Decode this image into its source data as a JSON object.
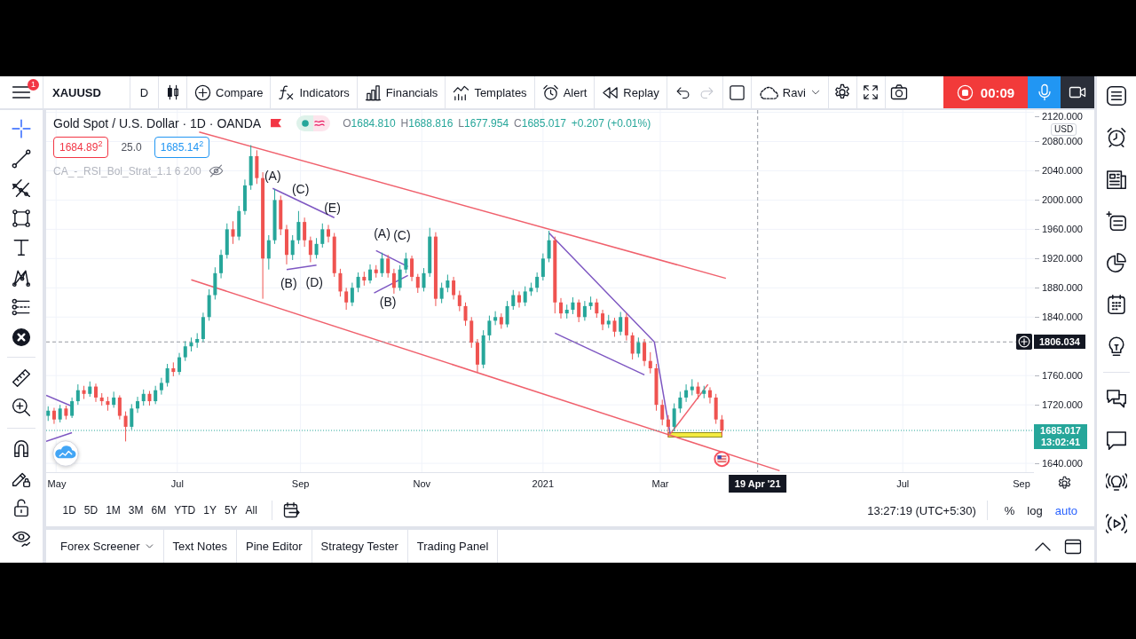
{
  "toolbar": {
    "notification_count": "1",
    "symbol": "XAUUSD",
    "interval": "D",
    "actions": [
      {
        "label": "Compare"
      },
      {
        "label": "Indicators"
      },
      {
        "label": "Financials"
      },
      {
        "label": "Templates"
      },
      {
        "label": "Alert"
      },
      {
        "label": "Replay"
      }
    ],
    "history": [
      {
        "disabled": false
      },
      {
        "disabled": true
      }
    ],
    "layout_name": "Ravi"
  },
  "recorder": {
    "elapsed": "00:09"
  },
  "drawing_tools": [
    {
      "tools": [
        {
          "selected": true
        },
        {
          "selected": false
        },
        {
          "selected": false
        },
        {
          "selected": false
        },
        {
          "selected": false
        },
        {
          "selected": false
        },
        {
          "selected": false
        },
        {
          "selected": false
        }
      ]
    },
    {
      "tools": [
        {
          "selected": false
        },
        {
          "selected": false
        }
      ]
    },
    {
      "tools": [
        {
          "selected": false
        },
        {
          "selected": false
        },
        {
          "selected": false
        },
        {
          "selected": false
        }
      ]
    }
  ],
  "chart": {
    "legend": {
      "title": "Gold Spot / U.S. Dollar · 1D · OANDA",
      "ohlc": [
        {
          "label": "O",
          "value": "1684.810"
        },
        {
          "label": "H",
          "value": "1688.816"
        },
        {
          "label": "L",
          "value": "1677.954"
        },
        {
          "label": "C",
          "value": "1685.017"
        }
      ],
      "change": "+0.207 (+0.01%)",
      "sell_price": "1684.89$^{2}$",
      "spread": "25.0",
      "buy_price": "1685.14$^{2}$",
      "indicator": {
        "name": "CA_-_RSI_Bol_Strat_1.1 6 200",
        "hidden": true
      }
    },
    "currency": "USD",
    "countdown": "13:02:41",
    "chart_data": [
      {
        "type": "candlestick",
        "x": [
          "2020-04-27",
          "2020-04-30",
          "2020-05-03",
          "2020-05-06",
          "2020-05-09",
          "2020-05-12",
          "2020-05-15",
          "2020-05-18",
          "2020-05-21",
          "2020-05-24",
          "2020-05-27",
          "2020-05-30",
          "2020-06-02",
          "2020-06-05",
          "2020-06-08",
          "2020-06-11",
          "2020-06-14",
          "2020-06-17",
          "2020-06-20",
          "2020-06-23",
          "2020-06-26",
          "2020-06-29",
          "2020-07-02",
          "2020-07-05",
          "2020-07-08",
          "2020-07-11",
          "2020-07-14",
          "2020-07-17",
          "2020-07-20",
          "2020-07-23",
          "2020-07-26",
          "2020-07-29",
          "2020-08-01",
          "2020-08-04",
          "2020-08-07",
          "2020-08-10",
          "2020-08-13",
          "2020-08-16",
          "2020-08-19",
          "2020-08-22",
          "2020-08-25",
          "2020-08-28",
          "2020-08-31",
          "2020-09-03",
          "2020-09-06",
          "2020-09-09",
          "2020-09-12",
          "2020-09-15",
          "2020-09-18",
          "2020-09-21",
          "2020-09-24",
          "2020-09-27",
          "2020-09-30",
          "2020-10-03",
          "2020-10-06",
          "2020-10-09",
          "2020-10-12",
          "2020-10-15",
          "2020-10-18",
          "2020-10-21",
          "2020-10-24",
          "2020-10-27",
          "2020-10-30",
          "2020-11-02",
          "2020-11-05",
          "2020-11-08",
          "2020-11-11",
          "2020-11-14",
          "2020-11-17",
          "2020-11-20",
          "2020-11-23",
          "2020-11-26",
          "2020-11-29",
          "2020-12-02",
          "2020-12-05",
          "2020-12-08",
          "2020-12-11",
          "2020-12-14",
          "2020-12-17",
          "2020-12-20",
          "2020-12-23",
          "2020-12-26",
          "2020-12-29",
          "2021-01-01",
          "2021-01-04",
          "2021-01-07",
          "2021-01-10",
          "2021-01-13",
          "2021-01-16",
          "2021-01-19",
          "2021-01-22",
          "2021-01-25",
          "2021-01-28",
          "2021-01-31",
          "2021-02-03",
          "2021-02-06",
          "2021-02-09",
          "2021-02-12",
          "2021-02-15",
          "2021-02-18",
          "2021-02-21",
          "2021-02-24",
          "2021-02-27",
          "2021-03-02",
          "2021-03-05",
          "2021-03-08",
          "2021-03-11",
          "2021-03-14",
          "2021-03-17",
          "2021-03-20",
          "2021-03-23",
          "2021-03-26",
          "2021-03-29",
          "2021-04-01"
        ],
        "ohlc": [
          [
            1705,
            1718,
            1698,
            1712
          ],
          [
            1712,
            1716,
            1694,
            1700
          ],
          [
            1700,
            1720,
            1696,
            1715
          ],
          [
            1715,
            1719,
            1700,
            1705
          ],
          [
            1705,
            1730,
            1702,
            1725
          ],
          [
            1725,
            1748,
            1720,
            1740
          ],
          [
            1740,
            1746,
            1728,
            1735
          ],
          [
            1735,
            1752,
            1731,
            1745
          ],
          [
            1745,
            1749,
            1724,
            1730
          ],
          [
            1730,
            1736,
            1719,
            1725
          ],
          [
            1725,
            1731,
            1712,
            1720
          ],
          [
            1720,
            1738,
            1716,
            1730
          ],
          [
            1730,
            1733,
            1700,
            1705
          ],
          [
            1705,
            1711,
            1670,
            1690
          ],
          [
            1690,
            1721,
            1686,
            1715
          ],
          [
            1715,
            1731,
            1709,
            1725
          ],
          [
            1725,
            1741,
            1719,
            1735
          ],
          [
            1735,
            1739,
            1719,
            1725
          ],
          [
            1725,
            1746,
            1721,
            1740
          ],
          [
            1740,
            1757,
            1734,
            1750
          ],
          [
            1750,
            1776,
            1745,
            1770
          ],
          [
            1770,
            1778,
            1759,
            1765
          ],
          [
            1765,
            1791,
            1761,
            1785
          ],
          [
            1785,
            1807,
            1780,
            1800
          ],
          [
            1800,
            1812,
            1793,
            1805
          ],
          [
            1805,
            1818,
            1798,
            1810
          ],
          [
            1810,
            1846,
            1806,
            1840
          ],
          [
            1840,
            1878,
            1835,
            1870
          ],
          [
            1870,
            1908,
            1864,
            1900
          ],
          [
            1900,
            1932,
            1893,
            1925
          ],
          [
            1925,
            1968,
            1920,
            1960
          ],
          [
            1960,
            1971,
            1940,
            1950
          ],
          [
            1950,
            1992,
            1945,
            1985
          ],
          [
            1985,
            2028,
            1980,
            2020
          ],
          [
            2020,
            2075,
            2014,
            2060
          ],
          [
            2060,
            2068,
            2022,
            2030
          ],
          [
            2030,
            2038,
            1865,
            1920
          ],
          [
            1920,
            1952,
            1905,
            1945
          ],
          [
            1945,
            2015,
            1940,
            2000
          ],
          [
            2000,
            2006,
            1952,
            1960
          ],
          [
            1960,
            1966,
            1912,
            1925
          ],
          [
            1925,
            1952,
            1918,
            1945
          ],
          [
            1945,
            1985,
            1940,
            1970
          ],
          [
            1970,
            1976,
            1936,
            1945
          ],
          [
            1945,
            1950,
            1915,
            1925
          ],
          [
            1925,
            1948,
            1920,
            1940
          ],
          [
            1940,
            1968,
            1935,
            1960
          ],
          [
            1960,
            1966,
            1942,
            1950
          ],
          [
            1950,
            1955,
            1895,
            1900
          ],
          [
            1900,
            1906,
            1868,
            1875
          ],
          [
            1875,
            1880,
            1850,
            1860
          ],
          [
            1860,
            1887,
            1855,
            1880
          ],
          [
            1880,
            1901,
            1874,
            1895
          ],
          [
            1895,
            1902,
            1883,
            1890
          ],
          [
            1890,
            1912,
            1886,
            1905
          ],
          [
            1905,
            1911,
            1894,
            1900
          ],
          [
            1900,
            1928,
            1895,
            1920
          ],
          [
            1920,
            1925,
            1894,
            1900
          ],
          [
            1900,
            1906,
            1872,
            1880
          ],
          [
            1880,
            1911,
            1876,
            1905
          ],
          [
            1905,
            1928,
            1900,
            1920
          ],
          [
            1920,
            1924,
            1889,
            1895
          ],
          [
            1895,
            1899,
            1873,
            1880
          ],
          [
            1880,
            1907,
            1875,
            1900
          ],
          [
            1900,
            1962,
            1895,
            1950
          ],
          [
            1950,
            1956,
            1855,
            1865
          ],
          [
            1865,
            1887,
            1859,
            1880
          ],
          [
            1880,
            1898,
            1874,
            1890
          ],
          [
            1890,
            1895,
            1864,
            1870
          ],
          [
            1870,
            1876,
            1848,
            1855
          ],
          [
            1855,
            1860,
            1828,
            1835
          ],
          [
            1835,
            1840,
            1798,
            1805
          ],
          [
            1805,
            1810,
            1765,
            1775
          ],
          [
            1775,
            1822,
            1770,
            1815
          ],
          [
            1815,
            1842,
            1808,
            1835
          ],
          [
            1835,
            1848,
            1829,
            1840
          ],
          [
            1840,
            1845,
            1824,
            1830
          ],
          [
            1830,
            1862,
            1826,
            1855
          ],
          [
            1855,
            1877,
            1850,
            1870
          ],
          [
            1870,
            1875,
            1853,
            1860
          ],
          [
            1860,
            1882,
            1855,
            1875
          ],
          [
            1875,
            1887,
            1869,
            1880
          ],
          [
            1880,
            1901,
            1874,
            1895
          ],
          [
            1895,
            1927,
            1890,
            1920
          ],
          [
            1920,
            1958,
            1915,
            1945
          ],
          [
            1945,
            1950,
            1845,
            1860
          ],
          [
            1860,
            1866,
            1838,
            1845
          ],
          [
            1845,
            1857,
            1838,
            1850
          ],
          [
            1850,
            1867,
            1844,
            1860
          ],
          [
            1860,
            1864,
            1833,
            1840
          ],
          [
            1840,
            1862,
            1835,
            1855
          ],
          [
            1855,
            1868,
            1850,
            1860
          ],
          [
            1860,
            1865,
            1839,
            1845
          ],
          [
            1845,
            1850,
            1822,
            1830
          ],
          [
            1830,
            1843,
            1825,
            1835
          ],
          [
            1835,
            1839,
            1813,
            1820
          ],
          [
            1820,
            1847,
            1815,
            1840
          ],
          [
            1840,
            1845,
            1808,
            1815
          ],
          [
            1815,
            1819,
            1782,
            1790
          ],
          [
            1790,
            1812,
            1785,
            1805
          ],
          [
            1805,
            1810,
            1773,
            1780
          ],
          [
            1780,
            1792,
            1763,
            1770
          ],
          [
            1770,
            1776,
            1712,
            1720
          ],
          [
            1720,
            1727,
            1692,
            1700
          ],
          [
            1700,
            1706,
            1676,
            1690
          ],
          [
            1690,
            1722,
            1684,
            1715
          ],
          [
            1715,
            1738,
            1709,
            1730
          ],
          [
            1730,
            1748,
            1724,
            1740
          ],
          [
            1740,
            1755,
            1733,
            1745
          ],
          [
            1745,
            1751,
            1728,
            1735
          ],
          [
            1735,
            1746,
            1729,
            1740
          ],
          [
            1740,
            1744,
            1722,
            1730
          ],
          [
            1730,
            1735,
            1694,
            1700
          ],
          [
            1700,
            1706,
            1678,
            1685
          ]
        ],
        "series": [
          {
            "type": "line",
            "x": [
              "2020-07-12",
              "2021-04-03"
            ],
            "values": [
              2093,
              1893
            ],
            "color": "#f0616d"
          },
          {
            "type": "line",
            "x": [
              "2020-07-08",
              "2021-04-30"
            ],
            "values": [
              1891,
              1630
            ],
            "color": "#f0616d"
          },
          {
            "type": "line",
            "x": [
              "2020-04-26",
              "2020-05-09"
            ],
            "values": [
              1733,
              1718
            ],
            "color": "#7e57c2"
          },
          {
            "type": "line",
            "x": [
              "2020-04-26",
              "2020-05-09"
            ],
            "values": [
              1670,
              1682
            ],
            "color": "#7e57c2"
          },
          {
            "type": "line",
            "x": [
              "2020-08-18",
              "2020-09-18"
            ],
            "values": [
              2016,
              1976
            ],
            "color": "#7e57c2"
          },
          {
            "type": "line",
            "x": [
              "2020-08-25",
              "2020-09-09"
            ],
            "values": [
              1905,
              1911
            ],
            "color": "#7e57c2"
          },
          {
            "type": "line",
            "x": [
              "2020-10-09",
              "2020-10-25"
            ],
            "values": [
              1931,
              1909
            ],
            "color": "#7e57c2"
          },
          {
            "type": "line",
            "x": [
              "2020-10-08",
              "2020-10-25"
            ],
            "values": [
              1873,
              1897
            ],
            "color": "#7e57c2"
          },
          {
            "type": "line",
            "x": [
              "2021-01-04",
              "2021-02-26",
              "2021-03-06"
            ],
            "values": [
              1955,
              1806,
              1680
            ],
            "color": "#7e57c2"
          },
          {
            "type": "line",
            "x": [
              "2021-01-07",
              "2021-02-21"
            ],
            "values": [
              1818,
              1761
            ],
            "color": "#7e57c2"
          },
          {
            "type": "line",
            "x": [
              "2021-03-06",
              "2021-03-25"
            ],
            "values": [
              1680,
              1748
            ],
            "color": "#f0616d"
          }
        ],
        "xlim": [
          "2020-04-26",
          "2021-09-05"
        ],
        "ylim": [
          1628,
          2123
        ],
        "xticks": [
          {
            "value": "2020-05-01",
            "label": "May"
          },
          {
            "value": "2020-07-01",
            "label": "Jul"
          },
          {
            "value": "2020-09-01",
            "label": "Sep"
          },
          {
            "value": "2020-11-01",
            "label": "Nov"
          },
          {
            "value": "2021-01-01",
            "label": "2021"
          },
          {
            "value": "2021-03-01",
            "label": "Mar"
          },
          {
            "value": "2021-07-01",
            "label": "Jul"
          },
          {
            "value": "2021-09-01",
            "label": "Sep"
          }
        ],
        "yticks": [
          {
            "value": 2120,
            "label": "2120.000"
          },
          {
            "value": 2080,
            "label": "2080.000"
          },
          {
            "value": 2040,
            "label": "2040.000"
          },
          {
            "value": 2000,
            "label": "2000.000"
          },
          {
            "value": 1960,
            "label": "1960.000"
          },
          {
            "value": 1920,
            "label": "1920.000"
          },
          {
            "value": 1880,
            "label": "1880.000"
          },
          {
            "value": 1840,
            "label": "1840.000"
          },
          {
            "value": 1760,
            "label": "1760.000"
          },
          {
            "value": 1720,
            "label": "1720.000"
          },
          {
            "value": 1640,
            "label": "1640.000"
          }
        ],
        "grid": true,
        "ref_lines": [
          {
            "axis": "y",
            "value": 1685.017,
            "label": "1685.017",
            "color": "#26a69a",
            "line_style": "dotted"
          },
          {
            "axis": "x",
            "value": "2021-04-19",
            "label": "19 Apr '21",
            "color": "#9598a1",
            "line_style": "dashed"
          },
          {
            "axis": "y",
            "value": 1806.034,
            "label": "1806.034",
            "color": "#9598a1",
            "line_style": "dashed"
          }
        ],
        "annotations": [
          "(A)",
          "(C)",
          "(E)",
          "(B)",
          "(D)",
          "(A)",
          "(C)",
          "(B)"
        ]
      }
    ]
  },
  "range_bar": {
    "ranges": [
      "1D",
      "5D",
      "1M",
      "3M",
      "6M",
      "YTD",
      "1Y",
      "5Y",
      "All"
    ],
    "clock": "13:27:19 (UTC+5:30)",
    "scale_modes": [
      {
        "label": "%",
        "selected": false
      },
      {
        "label": "log",
        "selected": false
      },
      {
        "label": "auto",
        "selected": true
      }
    ]
  },
  "bottom_panel": {
    "tabs": [
      {
        "label": "Forex Screener",
        "menu": true,
        "selected": false
      },
      {
        "label": "Text Notes",
        "menu": false,
        "selected": false
      },
      {
        "label": "Pine Editor",
        "menu": false,
        "selected": false
      },
      {
        "label": "Strategy Tester",
        "menu": false,
        "selected": false
      },
      {
        "label": "Trading Panel",
        "menu": false,
        "selected": false
      }
    ]
  }
}
